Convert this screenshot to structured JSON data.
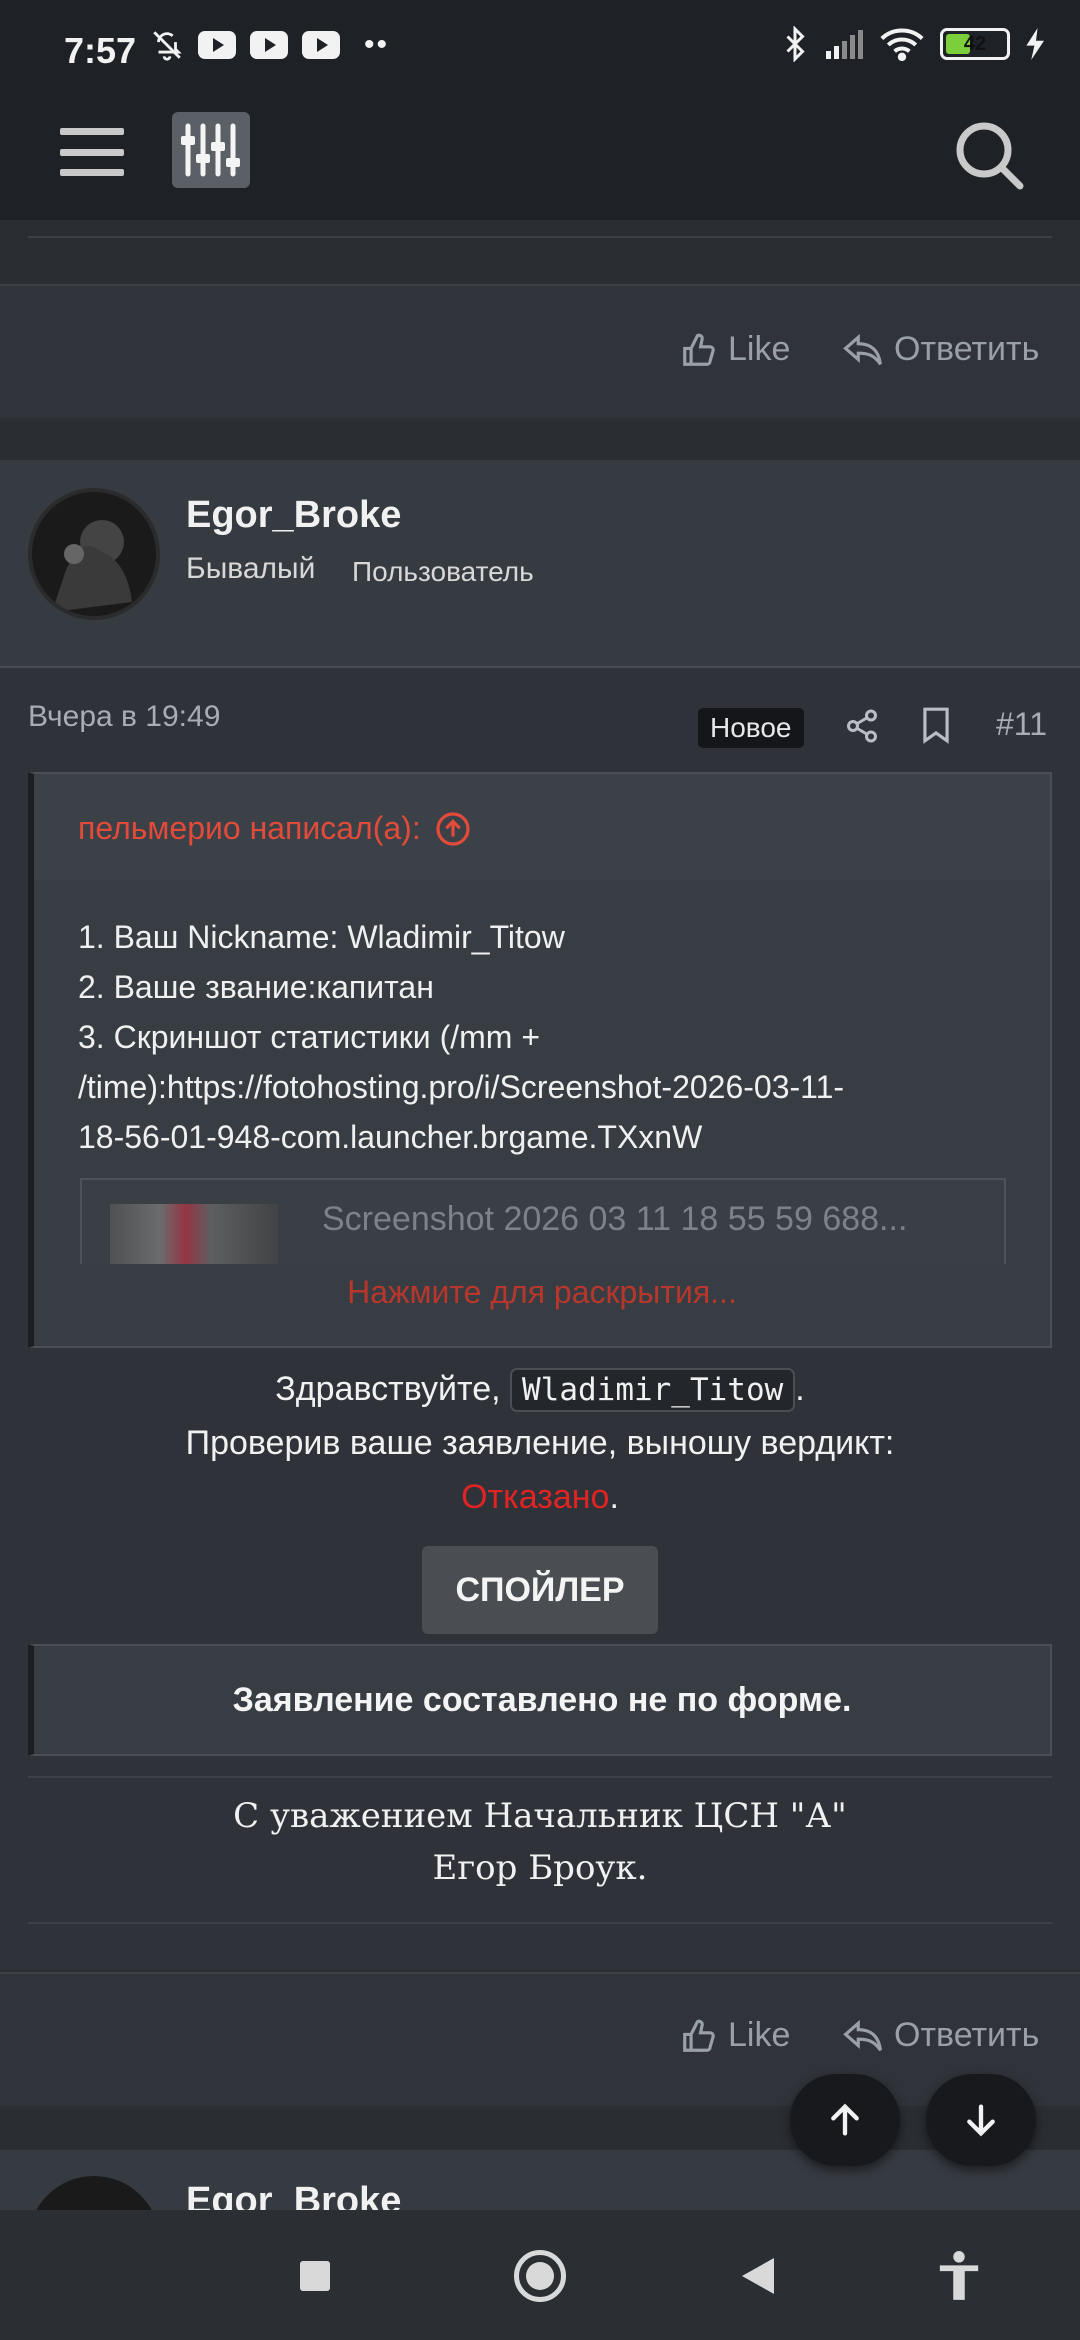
{
  "status_bar": {
    "time": "7:57",
    "battery_level": "42",
    "battery_fraction": 0.42,
    "icons": [
      "bell-off-icon",
      "youtube-icon",
      "youtube-icon",
      "youtube-icon",
      "more-dots-icon",
      "bluetooth-icon",
      "signal-icon",
      "wifi-icon",
      "battery-icon",
      "charging-icon"
    ],
    "dots": "••"
  },
  "top_nav": {
    "menu_icon": "hamburger-icon",
    "filter_icon": "sliders-icon",
    "search_icon": "search-icon"
  },
  "prev_post_actions": {
    "like_label": "Like",
    "reply_label": "Ответить"
  },
  "post": {
    "username": "Egor_Broke",
    "user_title": "Бывалый",
    "user_banner": "Пользователь",
    "date": "Вчера в 19:49",
    "new_badge": "Новое",
    "number": "#11",
    "quote": {
      "author": "пельмерио написал(а):",
      "lines": [
        "1. Ваш Nickname: Wladimir_Titow",
        "2. Ваше звание:капитан",
        "3. Скриншот статистики (/mm +",
        "/time):https://fotohosting.pro/i/Screenshot-2026-03-11-",
        "18-56-01-948-com.launcher.brgame.TXxnW"
      ],
      "attachment_name": "Screenshot 2026 03 11 18 55 59 688...",
      "expand_label": "Нажмите для раскрытия..."
    },
    "greeting_prefix": "Здравствуйте, ",
    "greeting_name": "Wladimir_Titow",
    "greeting_suffix": ".",
    "verdict_line": "Проверив ваше заявление, выношу вердикт:",
    "verdict": "Отказано",
    "verdict_suffix": ".",
    "spoiler_label": "СПОЙЛЕР",
    "notice": "Заявление составлено не по форме.",
    "signature_line1": "С уважением Начальник ЦСН \"А\"",
    "signature_line2": "Егор Броук.",
    "like_label": "Like",
    "reply_label": "Ответить"
  },
  "next_post": {
    "username": "Egor_Broke"
  },
  "scroll": {
    "up_icon": "arrow-up-icon",
    "down_icon": "arrow-down-icon"
  },
  "colors": {
    "accent_red": "#e02424",
    "quote_author": "#e04b3a",
    "background": "#2a2d32"
  }
}
